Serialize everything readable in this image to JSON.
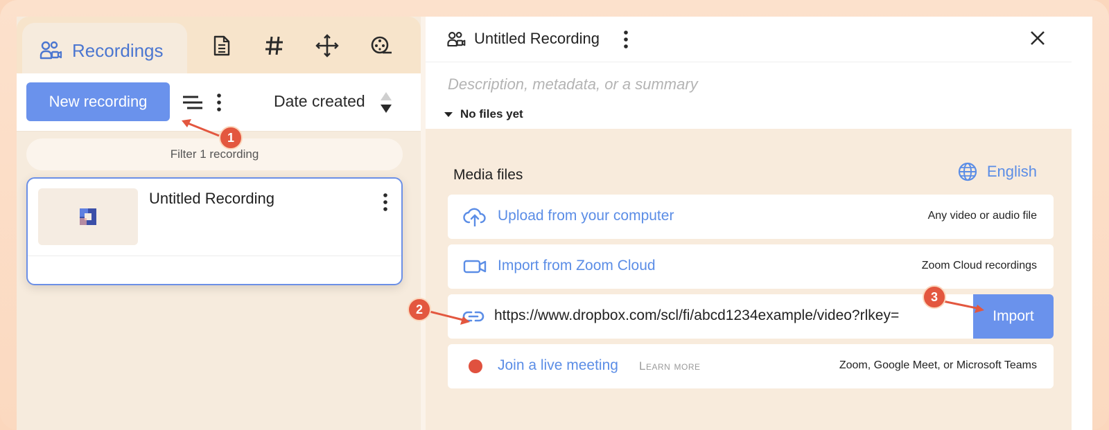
{
  "left_panel": {
    "tabs": {
      "active_label": "Recordings"
    },
    "toolbar": {
      "new_recording_label": "New recording",
      "sort_label": "Date created"
    },
    "filter_placeholder": "Filter 1 recording",
    "recordings": [
      {
        "title": "Untitled Recording"
      }
    ]
  },
  "right_panel": {
    "title": "Untitled Recording",
    "description_placeholder": "Description, metadata, or a summary",
    "files_status": "No files yet",
    "media": {
      "heading": "Media files",
      "language": "English",
      "upload": {
        "label": "Upload from your computer",
        "hint": "Any video or audio file"
      },
      "zoom": {
        "label": "Import from Zoom Cloud",
        "hint": "Zoom Cloud recordings"
      },
      "url_import": {
        "value": "https://www.dropbox.com/scl/fi/abcd1234example/video?rlkey=",
        "button_label": "Import"
      },
      "live": {
        "label": "Join a live meeting",
        "learn_more": "Learn more",
        "hint": "Zoom, Google Meet, or Microsoft Teams"
      }
    }
  },
  "annotations": {
    "step_1": "1",
    "step_2": "2",
    "step_3": "3"
  },
  "colors": {
    "accent": "#6a92ec",
    "link": "#5b8de6",
    "annotation": "#e3573f",
    "live": "#e0513e"
  }
}
